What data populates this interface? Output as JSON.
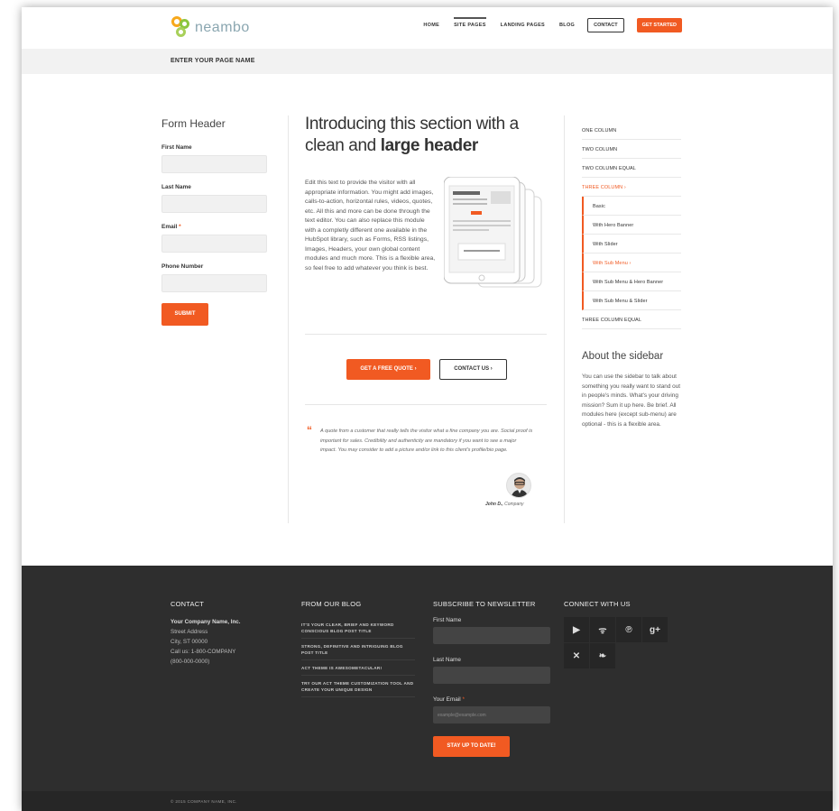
{
  "header": {
    "logo_text": "neambo",
    "nav": [
      {
        "label": "HOME"
      },
      {
        "label": "SITE PAGES"
      },
      {
        "label": "LANDING PAGES"
      },
      {
        "label": "BLOG"
      }
    ],
    "contact_label": "CONTACT",
    "start_label": "GET STARTED",
    "accent": "#f15a22"
  },
  "page_name": "ENTER YOUR PAGE NAME",
  "form": {
    "title": "Form Header",
    "fields": [
      {
        "label": "First Name",
        "required": ""
      },
      {
        "label": "Last Name",
        "required": ""
      },
      {
        "label": "Email",
        "required": "*"
      },
      {
        "label": "Phone Number",
        "required": ""
      }
    ],
    "submit_label": "SUBMIT"
  },
  "main": {
    "title_line1": "Introducing this section with a",
    "title_line2_plain": "clean and ",
    "title_line2_bold": "large header",
    "body": "Edit this text to provide the visitor with all appropriate information. You might add images, calls-to-action, horizontal rules, videos, quotes, etc. All this and more can be done through the text editor. You can also replace this module with a completly different one available in the HubSpot library, such as Forms, RSS listings, Images, Headers, your own global content modules and much more. This is a flexible area, so feel free to add whatever you think is best.",
    "quote_button": "GET A FREE QUOTE ›",
    "contact_button": "CONTACT US ›",
    "quote_text": "A quote from a customer that really tells the visitor what a fine company you are.  Social proof is important for sales. Credibility and authenticity are mandatory if you want to see a major impact. You may consider to add a picture and/or link to this client's profile/bio page.",
    "author_name": "John D.,",
    "author_company": "Company"
  },
  "sidebar": {
    "items": [
      {
        "label": "ONE COLUMN",
        "type": "top"
      },
      {
        "label": "TWO COLUMN",
        "type": "top"
      },
      {
        "label": "TWO COLUMN EQUAL",
        "type": "top"
      },
      {
        "label": "THREE COLUMN  ›",
        "type": "top-active"
      },
      {
        "label": "Basic",
        "type": "sub"
      },
      {
        "label": "With Hero Banner",
        "type": "sub"
      },
      {
        "label": "With Slider",
        "type": "sub"
      },
      {
        "label": "With Sub Menu  ›",
        "type": "sub-active"
      },
      {
        "label": "With Sub Menu & Hero Banner",
        "type": "sub"
      },
      {
        "label": "With Sub Menu & Slider",
        "type": "sub"
      },
      {
        "label": "THREE COLUMN EQUAL",
        "type": "top"
      }
    ],
    "about_title": "About the sidebar",
    "about_text": "You can use the sidebar to talk about something you really want to stand out in people's minds. What's your driving mission? Sum it up here. Be brief. All modules here (except sub-menu) are optional - this is a flexible area."
  },
  "footer": {
    "contact_title": "CONTACT",
    "company": "Your Company Name, Inc.",
    "street": "Street Address",
    "city": "City, ST 00000",
    "call": "Call us: 1-800-COMPANY",
    "phone": "(800-000-0000)",
    "blog_title": "FROM OUR BLOG",
    "blog_posts": [
      "IT'S YOUR CLEAR, BRIEF AND KEYWORD CONSCIOUS BLOG POST TITLE",
      "STRONG, DEFINITIVE AND INTRIGUING BLOG POST TITLE",
      "ACT THEME IS AWESOMETACULAR!",
      "TRY OUR ACT THEME CUSTOMIZATION TOOL AND CREATE YOUR UNIQUE DESIGN"
    ],
    "newsletter_title": "SUBSCRIBE TO NEWSLETTER",
    "first_name_label": "First Name",
    "last_name_label": "Last Name",
    "email_label": "Your Email",
    "email_required": "*",
    "email_placeholder": "example@example.com",
    "newsletter_button": "STAY UP TO DATE!",
    "connect_title": "CONNECT WITH US",
    "socials": [
      {
        "icon": "youtube-icon",
        "glyph": "▶"
      },
      {
        "icon": "rss-icon",
        "glyph": "ᯤ"
      },
      {
        "icon": "pinterest-icon",
        "glyph": "℗"
      },
      {
        "icon": "google-plus-icon",
        "glyph": "g+"
      },
      {
        "icon": "xing-icon",
        "glyph": "✕"
      },
      {
        "icon": "twitter-icon",
        "glyph": "❧"
      }
    ],
    "copyright": "© 2015 COMPANY NAME, INC."
  }
}
